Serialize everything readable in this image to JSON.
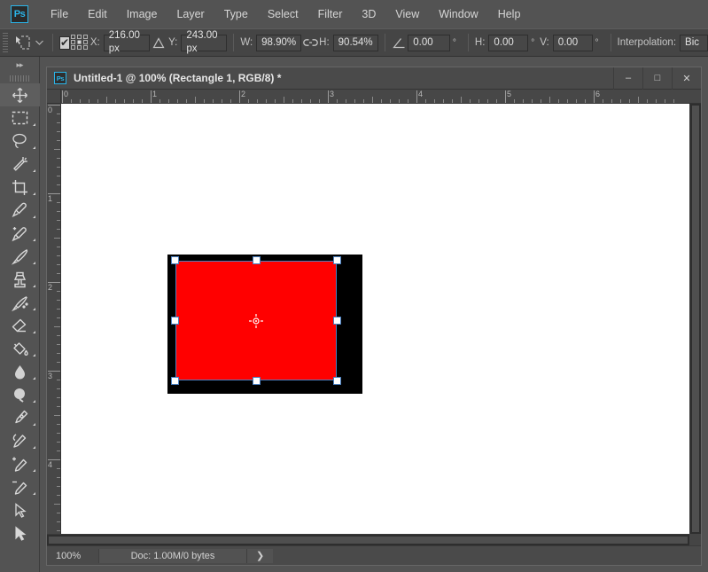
{
  "app": {
    "name": "Adobe Photoshop",
    "logo_text": "Ps",
    "accent_color": "#2ab4e8"
  },
  "menubar": {
    "items": [
      {
        "label": "File"
      },
      {
        "label": "Edit"
      },
      {
        "label": "Image"
      },
      {
        "label": "Layer"
      },
      {
        "label": "Type"
      },
      {
        "label": "Select"
      },
      {
        "label": "Filter"
      },
      {
        "label": "3D"
      },
      {
        "label": "View"
      },
      {
        "label": "Window"
      },
      {
        "label": "Help"
      }
    ]
  },
  "options_bar": {
    "tool_icon": "free-transform-icon",
    "tool_preset_chevron": "chevron-down-icon",
    "auto_select_checkbox": {
      "checked": true,
      "glyph": "✔"
    },
    "reference_point_icon": "reference-point-grid-icon",
    "x": {
      "label": "X:",
      "value": "216.00 px"
    },
    "delta_icon": "delta-triangle-icon",
    "y": {
      "label": "Y:",
      "value": "243.00 px"
    },
    "w": {
      "label": "W:",
      "value": "98.90%"
    },
    "link_icon": "link-chain-icon",
    "h_scale": {
      "label": "H:",
      "value": "90.54%"
    },
    "angle": {
      "icon": "rotate-angle-icon",
      "value": "0.00",
      "unit": "°"
    },
    "skew_h": {
      "label": "H:",
      "value": "0.00",
      "unit": "°"
    },
    "skew_v": {
      "label": "V:",
      "value": "0.00",
      "unit": "°"
    },
    "interpolation": {
      "label": "Interpolation:",
      "value": "Bic"
    }
  },
  "toolbar": {
    "collapse_glyph": "▸▸",
    "tools": [
      {
        "name": "move-tool",
        "active": true,
        "submenu": false
      },
      {
        "name": "rectangular-marquee-tool",
        "active": false,
        "submenu": true
      },
      {
        "name": "lasso-tool",
        "active": false,
        "submenu": true
      },
      {
        "name": "magic-wand-tool",
        "active": false,
        "submenu": true
      },
      {
        "name": "crop-tool",
        "active": false,
        "submenu": true
      },
      {
        "name": "eyedropper-tool",
        "active": false,
        "submenu": true
      },
      {
        "name": "healing-brush-tool",
        "active": false,
        "submenu": true
      },
      {
        "name": "brush-tool",
        "active": false,
        "submenu": true
      },
      {
        "name": "clone-stamp-tool",
        "active": false,
        "submenu": true
      },
      {
        "name": "history-brush-tool",
        "active": false,
        "submenu": true
      },
      {
        "name": "eraser-tool",
        "active": false,
        "submenu": true
      },
      {
        "name": "gradient-tool",
        "active": false,
        "submenu": true
      },
      {
        "name": "blur-tool",
        "active": false,
        "submenu": true
      },
      {
        "name": "dodge-tool",
        "active": false,
        "submenu": true
      },
      {
        "name": "pen-tool",
        "active": false,
        "submenu": true
      },
      {
        "name": "type-tool",
        "active": false,
        "submenu": true
      },
      {
        "name": "path-add-anchor-tool",
        "active": false,
        "submenu": true
      },
      {
        "name": "path-delete-anchor-tool",
        "active": false,
        "submenu": true
      },
      {
        "name": "path-selection-tool",
        "active": false,
        "submenu": false
      },
      {
        "name": "direct-selection-tool",
        "active": false,
        "submenu": false
      }
    ]
  },
  "document": {
    "title": "Untitled-1 @ 100% (Rectangle 1, RGB/8) *",
    "icon": "ps-document-icon",
    "window_controls": {
      "minimize": "–",
      "maximize": "□",
      "close": "✕"
    }
  },
  "rulers": {
    "unit_spacing_px": 100,
    "horizontal_labels": [
      "0",
      "1",
      "2",
      "3",
      "4",
      "5",
      "6"
    ],
    "vertical_labels": [
      "0",
      "1",
      "2",
      "3",
      "4"
    ]
  },
  "canvas": {
    "background": "#ffffff",
    "layer_color": "#000000",
    "shape_color": "#ff0000",
    "selection_border_color": "#4a7fbf",
    "handle_color": "#ffffff",
    "pivot_icon": "transform-pivot-icon",
    "handles": [
      "top-left",
      "top-center",
      "top-right",
      "middle-left",
      "middle-right",
      "bottom-left",
      "bottom-center",
      "bottom-right"
    ]
  },
  "status_bar": {
    "zoom": "100%",
    "doc_info": "Doc: 1.00M/0 bytes",
    "expand_arrow": "❯"
  }
}
